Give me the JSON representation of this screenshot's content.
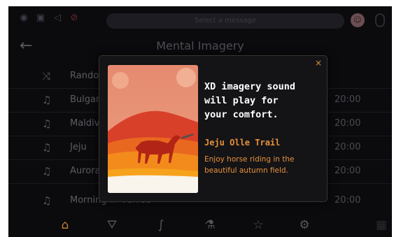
{
  "status_bar": {
    "message_placeholder": "Select a message",
    "icons": [
      "wifi-icon",
      "battery-icon",
      "volume-icon",
      "mute-icon",
      "avatar",
      "phone-icon"
    ]
  },
  "header": {
    "title": "Mental Imagery"
  },
  "list": {
    "items": [
      {
        "icon": "shuffle-icon",
        "title": "Random",
        "time": ""
      },
      {
        "icon": "music-note-icon",
        "title": "Bulgaria",
        "time": "20:00"
      },
      {
        "icon": "music-note-icon",
        "title": "Maldives",
        "time": "20:00"
      },
      {
        "icon": "music-note-icon",
        "title": "Jeju",
        "time": "20:00"
      },
      {
        "icon": "music-note-icon",
        "title": "Aurora",
        "time": "20:00"
      },
      {
        "icon": "music-note-icon",
        "title": "Morning in Venice",
        "time": "20:00"
      }
    ]
  },
  "modal": {
    "heading": "XD imagery sound\nwill play for\nyour comfort.",
    "subtitle": "Jeju Olle Trail",
    "description": "Enjoy horse riding in the beautiful autumn field.",
    "close_glyph": "×"
  },
  "bottom_nav": {
    "items": [
      {
        "name": "home-icon",
        "glyph": "⌂",
        "active": true
      },
      {
        "name": "car-icon",
        "glyph": "⛛",
        "active": false
      },
      {
        "name": "route-icon",
        "glyph": "∫",
        "active": false
      },
      {
        "name": "climate-icon",
        "glyph": "⚗",
        "active": false
      },
      {
        "name": "star-icon",
        "glyph": "☆",
        "active": false
      },
      {
        "name": "gear-icon",
        "glyph": "⚙",
        "active": false
      },
      {
        "name": "grid-icon",
        "glyph": "▦",
        "active": false
      }
    ]
  },
  "colors": {
    "accent": "#e6913a",
    "modal_bg": "#141417",
    "screen_bg": "#0b0b0e"
  }
}
